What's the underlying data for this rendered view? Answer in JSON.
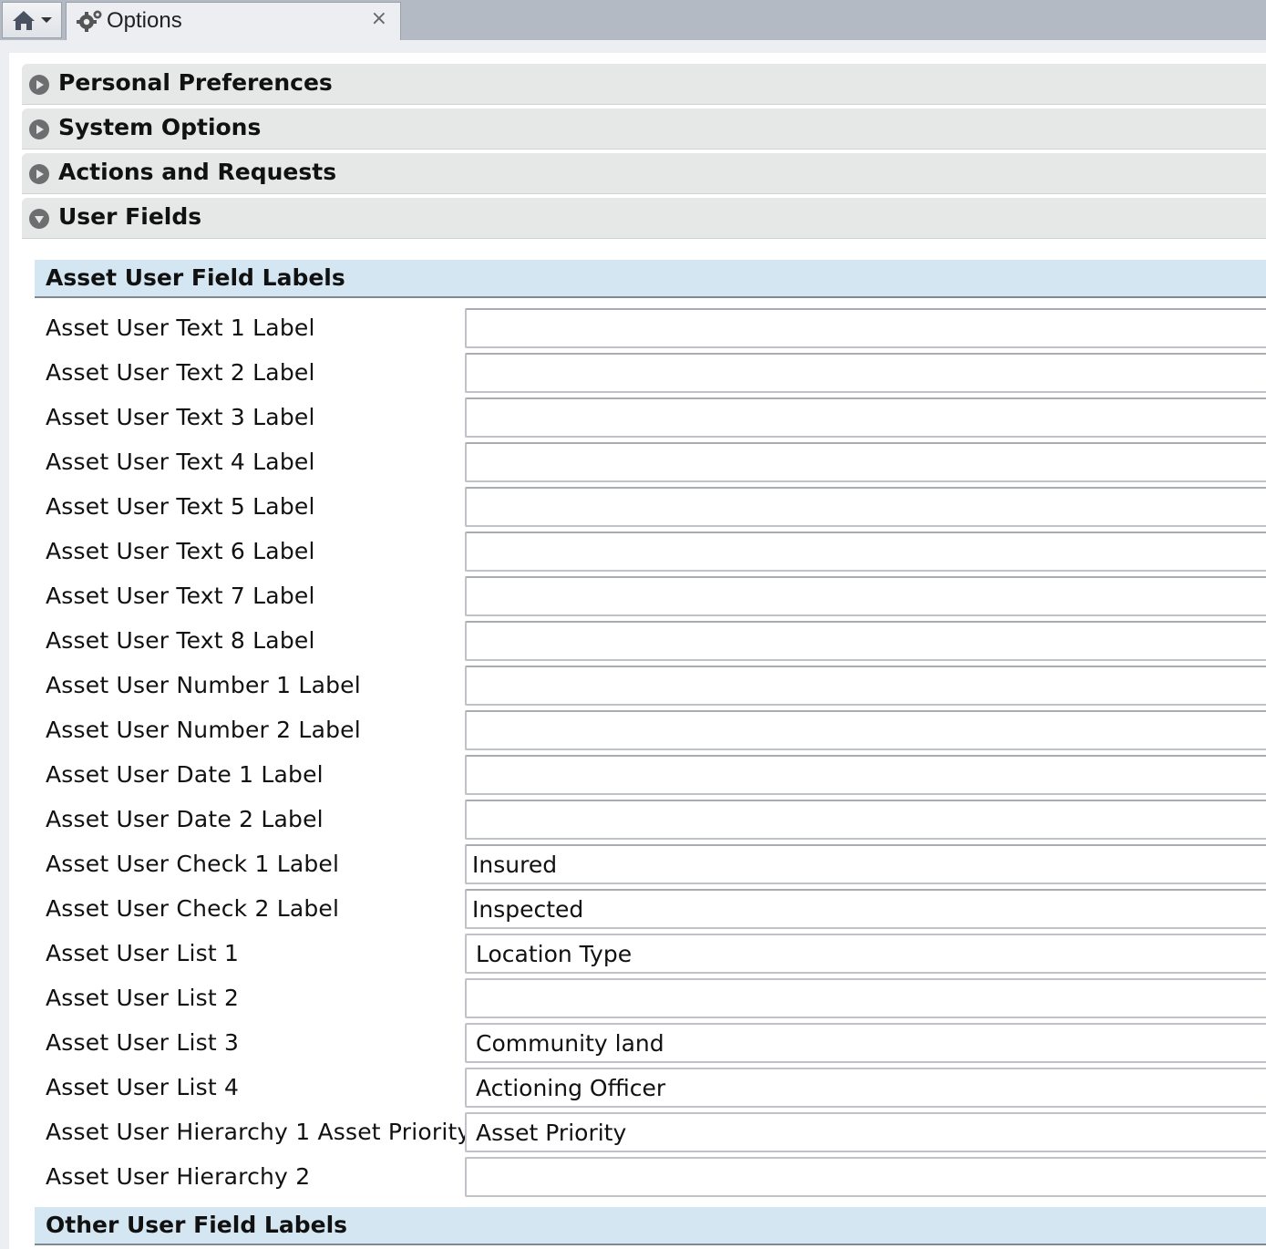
{
  "tabs": {
    "home_menu": "home",
    "active_tab": {
      "title": "Options",
      "close": "×"
    }
  },
  "accordion": [
    {
      "label": "Personal Preferences",
      "expanded": false
    },
    {
      "label": "System Options",
      "expanded": false
    },
    {
      "label": "Actions and Requests",
      "expanded": false
    },
    {
      "label": "User Fields",
      "expanded": true
    }
  ],
  "sections": {
    "asset": "Asset User Field Labels",
    "other": "Other User Field Labels"
  },
  "fields": [
    {
      "label": "Asset User Text 1 Label",
      "value": "",
      "type": "text"
    },
    {
      "label": "Asset User Text 2 Label",
      "value": "",
      "type": "text"
    },
    {
      "label": "Asset User Text 3 Label",
      "value": "",
      "type": "text"
    },
    {
      "label": "Asset User Text 4 Label",
      "value": "",
      "type": "text"
    },
    {
      "label": "Asset User Text 5 Label",
      "value": "",
      "type": "text"
    },
    {
      "label": "Asset User Text 6 Label",
      "value": "",
      "type": "text"
    },
    {
      "label": "Asset User Text 7 Label",
      "value": "",
      "type": "text"
    },
    {
      "label": "Asset User Text 8 Label",
      "value": "",
      "type": "text"
    },
    {
      "label": "Asset User Number 1 Label",
      "value": "",
      "type": "text"
    },
    {
      "label": "Asset User Number 2 Label",
      "value": "",
      "type": "text"
    },
    {
      "label": "Asset User Date 1 Label",
      "value": "",
      "type": "text"
    },
    {
      "label": "Asset User Date 2 Label",
      "value": "",
      "type": "text"
    },
    {
      "label": "Asset User Check 1 Label",
      "value": "Insured",
      "type": "text"
    },
    {
      "label": "Asset User Check 2 Label",
      "value": "Inspected",
      "type": "text"
    },
    {
      "label": "Asset User List 1",
      "value": "Location Type",
      "type": "select"
    },
    {
      "label": "Asset User List 2",
      "value": "",
      "type": "select"
    },
    {
      "label": "Asset User List 3",
      "value": "Community land",
      "type": "select"
    },
    {
      "label": "Asset User List 4",
      "value": "Actioning Officer",
      "type": "select"
    },
    {
      "label": "Asset User Hierarchy 1 Asset Priority",
      "value": "Asset Priority",
      "type": "select"
    },
    {
      "label": "Asset User Hierarchy 2",
      "value": "",
      "type": "select"
    }
  ]
}
